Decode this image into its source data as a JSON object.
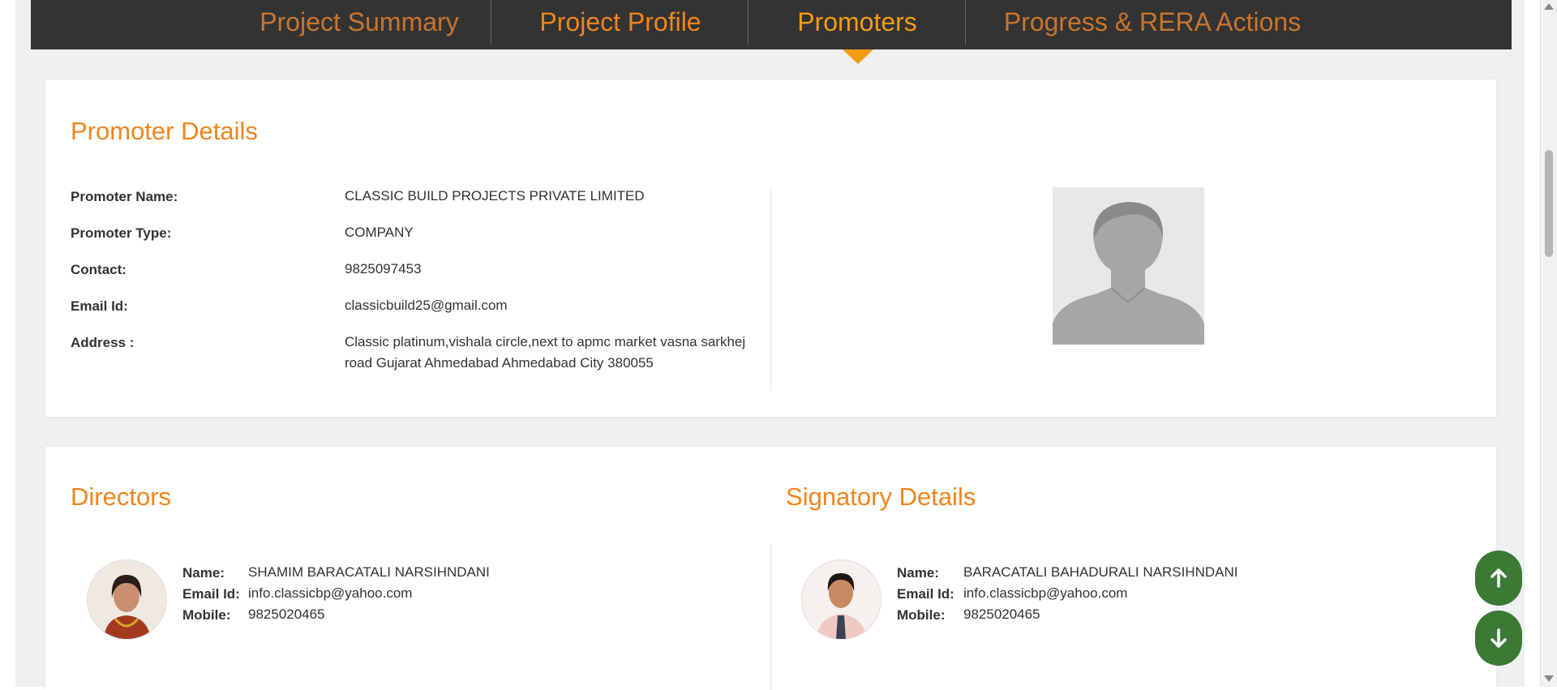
{
  "tabs": [
    {
      "label": "Project Summary",
      "active": false
    },
    {
      "label": "Project Profile",
      "active": false
    },
    {
      "label": "Promoters",
      "active": true
    },
    {
      "label": "Progress & RERA Actions",
      "active": false
    }
  ],
  "promoter": {
    "title": "Promoter Details",
    "fields": [
      {
        "label": "Promoter Name:",
        "value": "CLASSIC BUILD PROJECTS PRIVATE LIMITED"
      },
      {
        "label": "Promoter Type:",
        "value": "COMPANY"
      },
      {
        "label": "Contact:",
        "value": "9825097453"
      },
      {
        "label": "Email Id:",
        "value": "classicbuild25@gmail.com"
      },
      {
        "label": "Address :",
        "value": "Classic platinum,vishala circle,next to apmc market vasna sarkhej road Gujarat Ahmedabad Ahmedabad City 380055"
      }
    ]
  },
  "directors": {
    "title": "Directors",
    "person": {
      "name_label": "Name:",
      "name": "SHAMIM BARACATALI NARSIHNDANI",
      "email_label": "Email Id:",
      "email": "info.classicbp@yahoo.com",
      "mobile_label": "Mobile:",
      "mobile": "9825020465"
    }
  },
  "signatory": {
    "title": "Signatory Details",
    "person": {
      "name_label": "Name:",
      "name": "BARACATALI BAHADURALI NARSIHNDANI",
      "email_label": "Email Id:",
      "email": "info.classicbp@yahoo.com",
      "mobile_label": "Mobile:",
      "mobile": "9825020465"
    }
  },
  "colors": {
    "accent": "#f0841d",
    "tab_active": "#f39c12",
    "tab_inactive": "#c8752c",
    "tab_bar": "#333333",
    "fab": "#3b7a35"
  },
  "icons": {
    "scroll_up": "arrow-up-icon",
    "scroll_down": "arrow-down-icon",
    "placeholder": "person-placeholder-icon"
  }
}
